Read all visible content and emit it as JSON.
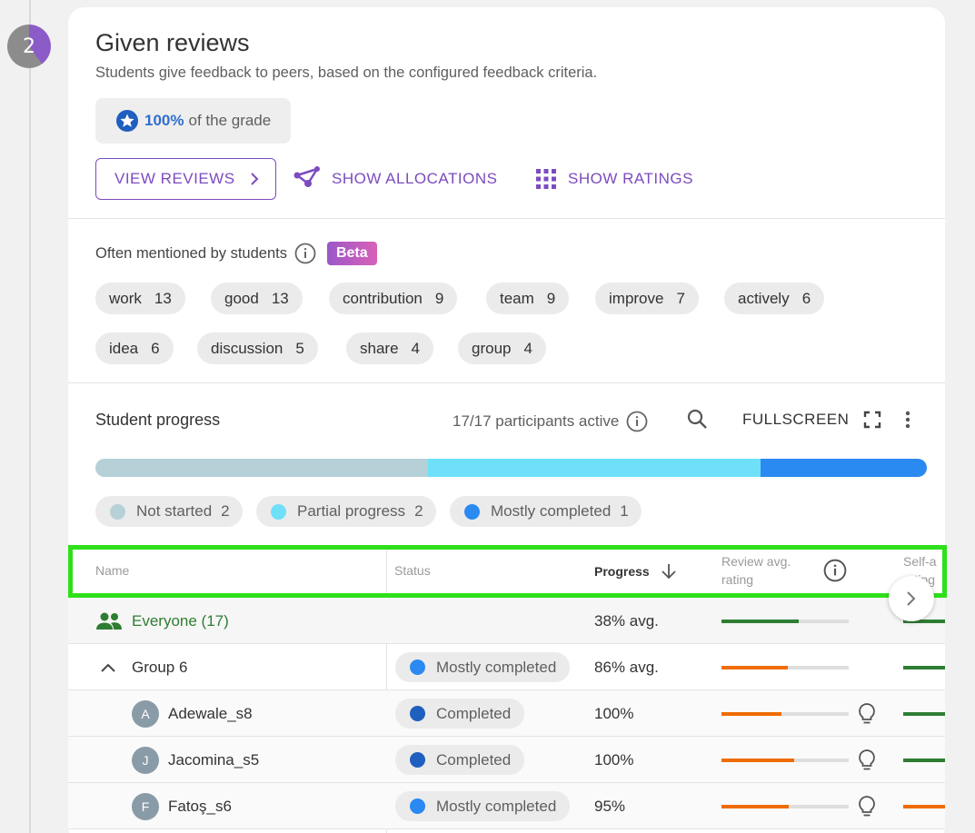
{
  "step": {
    "number": "2"
  },
  "header": {
    "title": "Given reviews",
    "subtitle": "Students give feedback to peers, based on the configured feedback criteria.",
    "grade_pct": "100%",
    "grade_suffix": "of the grade"
  },
  "actions": {
    "view_reviews": "VIEW REVIEWS",
    "show_allocations": "SHOW ALLOCATIONS",
    "show_ratings": "SHOW RATINGS"
  },
  "mentions": {
    "label": "Often mentioned by students",
    "badge": "Beta",
    "tags": [
      {
        "word": "work",
        "count": "13"
      },
      {
        "word": "good",
        "count": "13"
      },
      {
        "word": "contribution",
        "count": "9"
      },
      {
        "word": "team",
        "count": "9"
      },
      {
        "word": "improve",
        "count": "7"
      },
      {
        "word": "actively",
        "count": "6"
      },
      {
        "word": "idea",
        "count": "6"
      },
      {
        "word": "discussion",
        "count": "5"
      },
      {
        "word": "share",
        "count": "4"
      },
      {
        "word": "group",
        "count": "4"
      }
    ]
  },
  "progress": {
    "title": "Student progress",
    "active": "17/17 participants active",
    "fullscreen": "FULLSCREEN",
    "bar": {
      "not_started": 2,
      "partial": 2,
      "mostly": 1
    },
    "legend": [
      {
        "label": "Not started",
        "count": "2",
        "color": "#b6d0d8"
      },
      {
        "label": "Partial progress",
        "count": "2",
        "color": "#6ee0fa"
      },
      {
        "label": "Mostly completed",
        "count": "1",
        "color": "#2b89f2"
      }
    ]
  },
  "table": {
    "headers": {
      "name": "Name",
      "status": "Status",
      "progress": "Progress",
      "review_line1": "Review avg.",
      "review_line2": "rating",
      "self_line1": "Self-a",
      "self_line2": "rating"
    },
    "everyone": {
      "label": "Everyone (17)",
      "progress": "38% avg.",
      "review_fraction": 0.61,
      "self_color": "#2e7d32"
    },
    "group": {
      "label": "Group 6",
      "status": "Mostly completed",
      "progress": "86% avg.",
      "review_fraction": 0.52
    },
    "rows": [
      {
        "initial": "A",
        "name": "Adewale_s8",
        "status": "Completed",
        "progress": "100%",
        "review_fraction": 0.47
      },
      {
        "initial": "J",
        "name": "Jacomina_s5",
        "status": "Completed",
        "progress": "100%",
        "review_fraction": 0.57
      },
      {
        "initial": "F",
        "name": "Fatoş_s6",
        "status": "Mostly completed",
        "progress": "95%",
        "review_fraction": 0.53
      }
    ]
  },
  "colors": {
    "accent": "#7c4bbf",
    "completed": "#1f5fbf",
    "mostly": "#2b89f2",
    "orange": "#ef6c00",
    "green": "#2e7d32",
    "highlight": "#2ee01a"
  }
}
